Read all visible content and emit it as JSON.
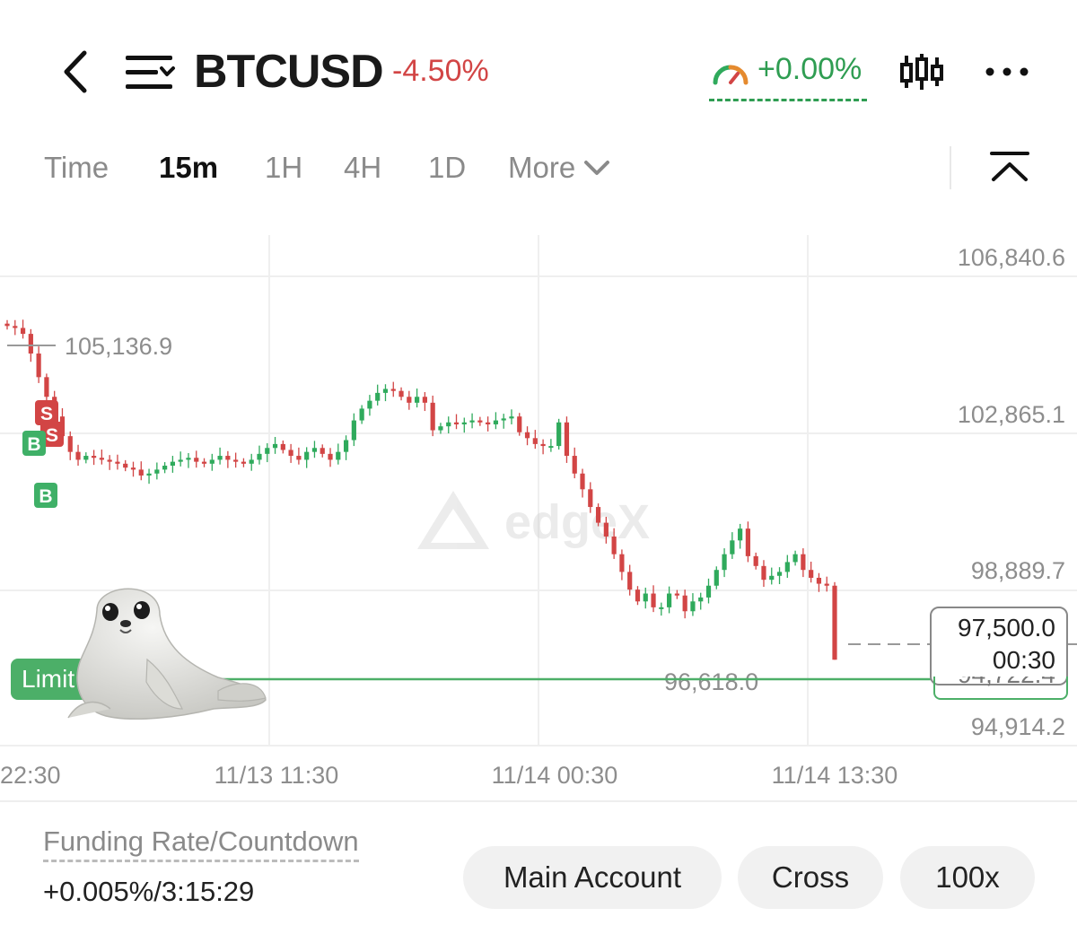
{
  "header": {
    "symbol": "BTCUSD",
    "change": "-4.50%",
    "funding_short": "+0.00%"
  },
  "timeframes": {
    "items": [
      "Time",
      "15m",
      "1H",
      "4H",
      "1D"
    ],
    "active": "15m",
    "more_label": "More"
  },
  "chart": {
    "watermark": "edgeX",
    "y_ticks": [
      "106,840.6",
      "102,865.1",
      "98,889.7",
      "94,914.2"
    ],
    "high_marker": "105,136.9",
    "low_marker": "96,618.0",
    "current_price": "97,500.0",
    "candle_countdown": "00:30",
    "limit_label": "Limit",
    "limit_price_partial": "94,722.4",
    "x_ticks": [
      "22:30",
      "11/13 11:30",
      "11/14 00:30",
      "11/14 13:30"
    ],
    "trade_markers": [
      "S",
      "S",
      "B",
      "B"
    ],
    "colors": {
      "up": "#2faa5c",
      "down": "#d24545",
      "limit": "#4caf68"
    }
  },
  "chart_data": {
    "type": "candlestick",
    "x_ticks": [
      "22:30",
      "11/13 11:30",
      "11/14 00:30",
      "11/14 13:30"
    ],
    "ylim": [
      94914.2,
      106840.6
    ],
    "y_ticks": [
      106840.6,
      102865.1,
      98889.7,
      94914.2
    ],
    "close_series": [
      105100,
      105050,
      104900,
      104400,
      103800,
      103300,
      102800,
      102300,
      101900,
      101700,
      101800,
      101750,
      101700,
      101650,
      101600,
      101500,
      101450,
      101300,
      101350,
      101450,
      101550,
      101650,
      101700,
      101750,
      101650,
      101600,
      101700,
      101800,
      101700,
      101650,
      101600,
      101700,
      101850,
      102000,
      102100,
      101950,
      101800,
      101700,
      101900,
      102000,
      101850,
      101700,
      101900,
      102200,
      102700,
      103000,
      103200,
      103400,
      103500,
      103450,
      103300,
      103150,
      103300,
      103150,
      102450,
      102550,
      102650,
      102600,
      102650,
      102700,
      102650,
      102600,
      102700,
      102750,
      102800,
      102400,
      102250,
      102100,
      102050,
      102050,
      102650,
      101800,
      101350,
      100950,
      100500,
      100100,
      99750,
      99300,
      98850,
      98400,
      98100,
      98300,
      97950,
      97950,
      98300,
      98250,
      97850,
      98100,
      98200,
      98500,
      98900,
      99300,
      99650,
      99950,
      99250,
      99000,
      98650,
      98750,
      98850,
      99100,
      99300,
      98900,
      98700,
      98550,
      98500,
      96618
    ],
    "high_marker": 105136.9,
    "low_marker": 96618.0,
    "current_price": 97500.0,
    "limit_price": 94722.4,
    "trades": [
      {
        "side": "S",
        "price": 103200
      },
      {
        "side": "S",
        "price": 102650
      },
      {
        "side": "B",
        "price": 102400
      },
      {
        "side": "B",
        "price": 101450
      }
    ]
  },
  "footer": {
    "funding_label": "Funding Rate/Countdown",
    "funding_value": "+0.005%/3:15:29",
    "account_button": "Main Account",
    "margin_button": "Cross",
    "leverage_button": "100x"
  }
}
